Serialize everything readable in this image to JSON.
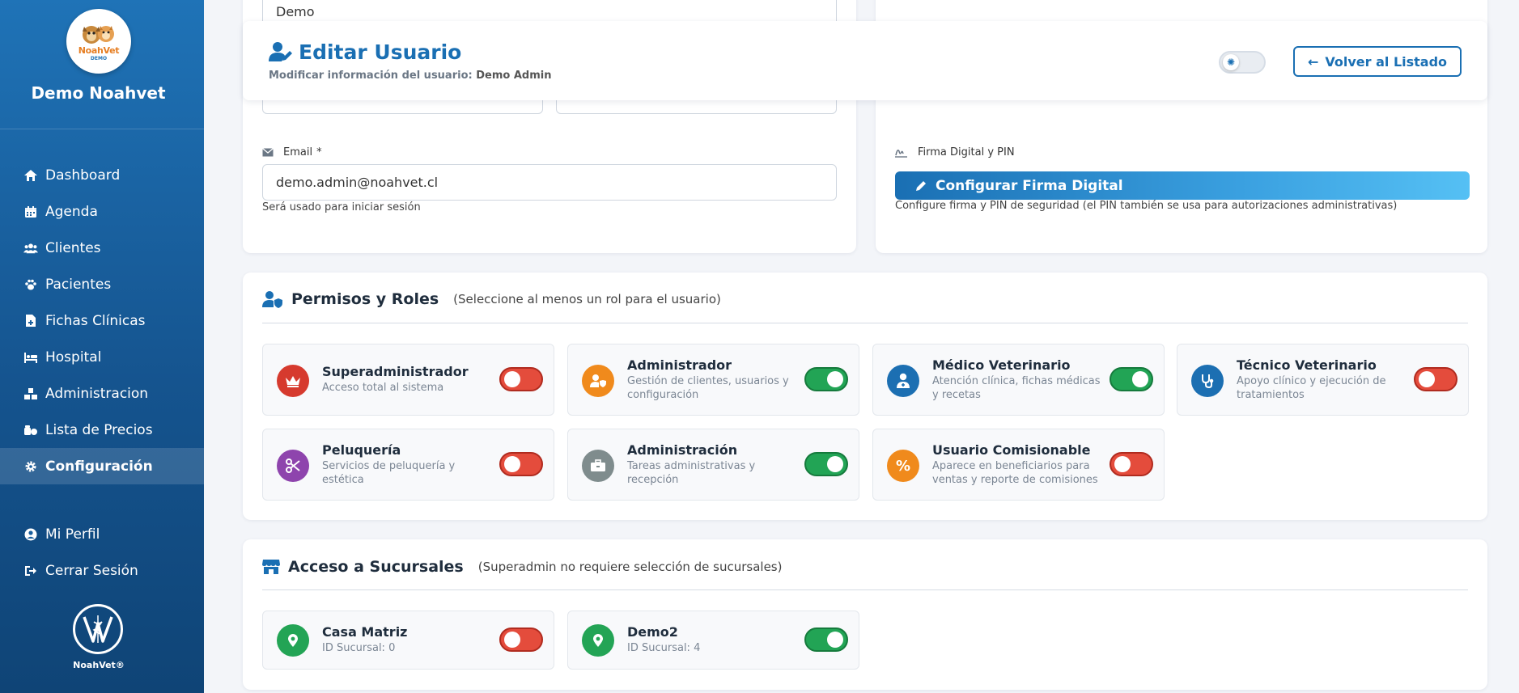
{
  "sidebar": {
    "logo_word": "NoahVet",
    "logo_sub": "DEMO",
    "brand_name": "Demo Noahvet",
    "items": [
      {
        "label": "Dashboard",
        "icon": "home-icon"
      },
      {
        "label": "Agenda",
        "icon": "calendar-icon"
      },
      {
        "label": "Clientes",
        "icon": "users-icon"
      },
      {
        "label": "Pacientes",
        "icon": "paw-icon"
      },
      {
        "label": "Fichas Clínicas",
        "icon": "file-medical-icon"
      },
      {
        "label": "Hospital",
        "icon": "hospital-bed-icon"
      },
      {
        "label": "Administracion",
        "icon": "cubes-icon"
      },
      {
        "label": "Lista de Precios",
        "icon": "price-tag-icon"
      },
      {
        "label": "Configuración",
        "icon": "gear-icon",
        "active": true
      }
    ],
    "bottom_items": [
      {
        "label": "Mi Perfil",
        "icon": "user-circle-icon"
      },
      {
        "label": "Cerrar Sesión",
        "icon": "logout-icon"
      }
    ],
    "footer_text": "NoahVet®"
  },
  "form": {
    "name_value": "Demo",
    "email_label": "Email",
    "required_mark": "*",
    "email_value": "demo.admin@noahvet.cl",
    "email_help": "Será usado para iniciar sesión",
    "signature_label": "Firma Digital y PIN",
    "signature_button": "Configurar Firma Digital",
    "signature_help": "Configure firma y PIN de seguridad (el PIN también se usa para autorizaciones administrativas)"
  },
  "header": {
    "title": "Editar Usuario",
    "subtitle_prefix": "Modificar información del usuario:",
    "subtitle_user": "Demo Admin",
    "back_button": "Volver al Listado"
  },
  "roles": {
    "title": "Permisos y Roles",
    "hint": "(Seleccione al menos un rol para el usuario)",
    "items": [
      {
        "name": "Superadministrador",
        "desc": "Acceso total al sistema",
        "enabled": false,
        "color": "#d63a2e"
      },
      {
        "name": "Administrador",
        "desc": "Gestión de clientes, usuarios y configuración",
        "enabled": true,
        "color": "#f08a1c"
      },
      {
        "name": "Médico Veterinario",
        "desc": "Atención clínica, fichas médicas y recetas",
        "enabled": true,
        "color": "#1c6fb2"
      },
      {
        "name": "Técnico Veterinario",
        "desc": "Apoyo clínico y ejecución de tratamientos",
        "enabled": false,
        "color": "#1c6fb2"
      },
      {
        "name": "Peluquería",
        "desc": "Servicios de peluquería y estética",
        "enabled": false,
        "color": "#8e44ad"
      },
      {
        "name": "Administración",
        "desc": "Tareas administrativas y recepción",
        "enabled": true,
        "color": "#7f8c8d"
      },
      {
        "name": "Usuario Comisionable",
        "desc": "Aparece en beneficiarios para ventas y reporte de comisiones",
        "enabled": false,
        "color": "#f08a1c"
      }
    ]
  },
  "branches": {
    "title": "Acceso a Sucursales",
    "hint": "(Superadmin no requiere selección de sucursales)",
    "items": [
      {
        "name": "Casa Matriz",
        "id_text": "ID Sucursal: 0",
        "enabled": false
      },
      {
        "name": "Demo2",
        "id_text": "ID Sucursal: 4",
        "enabled": true
      }
    ]
  }
}
